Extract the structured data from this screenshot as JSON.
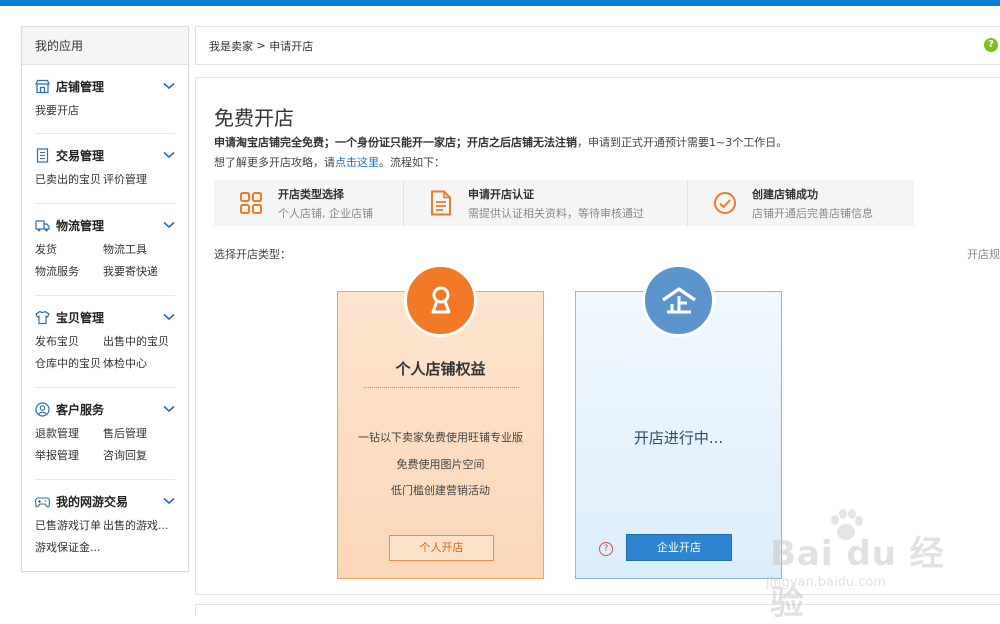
{
  "sidebar": {
    "title": "我的应用",
    "groups": [
      {
        "icon": "store-icon",
        "title": "店铺管理",
        "links": [
          "我要开店"
        ]
      },
      {
        "icon": "document-icon",
        "title": "交易管理",
        "links": [
          "已卖出的宝贝",
          "评价管理"
        ]
      },
      {
        "icon": "truck-icon",
        "title": "物流管理",
        "links": [
          "发货",
          "物流工具",
          "物流服务",
          "我要寄快递"
        ]
      },
      {
        "icon": "shirt-icon",
        "title": "宝贝管理",
        "links": [
          "发布宝贝",
          "出售中的宝贝",
          "仓库中的宝贝",
          "体检中心"
        ]
      },
      {
        "icon": "user-icon",
        "title": "客户服务",
        "links": [
          "退款管理",
          "售后管理",
          "举报管理",
          "咨询回复"
        ]
      },
      {
        "icon": "gamepad-icon",
        "title": "我的网游交易",
        "links": [
          "已售游戏订单",
          "出售的游戏...",
          "游戏保证金..."
        ]
      }
    ]
  },
  "breadcrumb": {
    "parent": "我是卖家",
    "separator": " > ",
    "current": "申请开店",
    "help": "?"
  },
  "main": {
    "title": "免费开店",
    "desc_bold": "申请淘宝店铺完全免费；一个身份证只能开一家店；开店之后店铺无法注销",
    "desc_rest": "，申请到正式开通预计需要1~3个工作日。",
    "guide_prefix": "想了解更多开店攻略，请",
    "guide_link": "点击这里",
    "guide_suffix": "。流程如下：",
    "steps": [
      {
        "icon": "grid-icon",
        "title": "开店类型选择",
        "sub": "个人店铺, 企业店铺"
      },
      {
        "icon": "file-icon",
        "title": "申请开店认证",
        "sub": "需提供认证相关资料，等待审核通过"
      },
      {
        "icon": "check-circle-icon",
        "title": "创建店铺成功",
        "sub": "店铺开通后完善店铺信息"
      }
    ],
    "choose_label": "选择开店类型：",
    "rules_link": "开店规"
  },
  "cards": {
    "personal": {
      "title": "个人店铺权益",
      "benefits": [
        "一钻以下卖家免费使用旺铺专业版",
        "免费使用图片空间",
        "低门槛创建营销活动"
      ],
      "button": "个人开店"
    },
    "company": {
      "status": "开店进行中...",
      "help": "?",
      "button": "企业开店"
    }
  },
  "watermark": {
    "logo": "Bai du 经验",
    "url": "jingyan.baidu.com"
  },
  "colors": {
    "topbar": "#0a7fd4",
    "accent_orange": "#f27a27",
    "accent_blue": "#2d84d0",
    "help_green": "#7cc11b",
    "link_blue": "#1a73c8"
  }
}
